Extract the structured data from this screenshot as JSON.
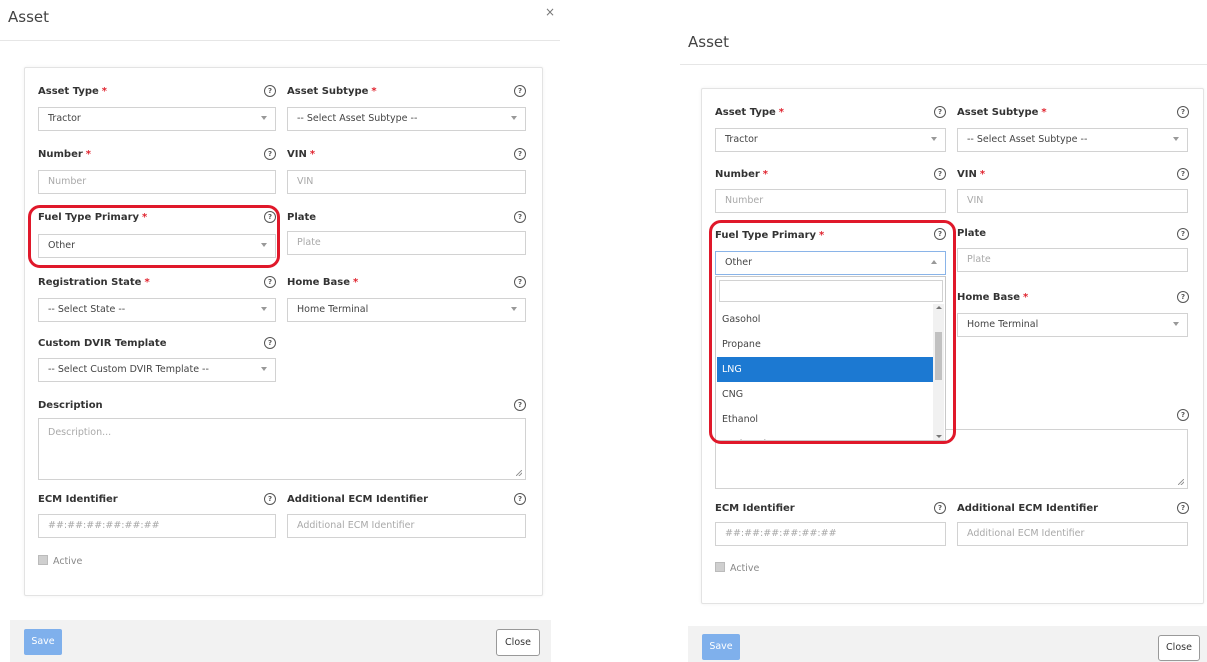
{
  "modal": {
    "title": "Asset",
    "close_x": "×",
    "fields": {
      "asset_type": {
        "label": "Asset Type",
        "value": "Tractor"
      },
      "asset_subtype": {
        "label": "Asset Subtype",
        "value": "-- Select Asset Subtype --"
      },
      "number": {
        "label": "Number",
        "placeholder": "Number"
      },
      "vin": {
        "label": "VIN",
        "placeholder": "VIN"
      },
      "fuel_type_primary": {
        "label": "Fuel Type Primary",
        "value": "Other"
      },
      "plate": {
        "label": "Plate",
        "placeholder": "Plate"
      },
      "registration_state": {
        "label": "Registration State",
        "value": "-- Select State --"
      },
      "home_base": {
        "label": "Home Base",
        "value": "Home Terminal"
      },
      "custom_dvir_template": {
        "label": "Custom DVIR Template",
        "value": "-- Select Custom DVIR Template --"
      },
      "description": {
        "label": "Description",
        "placeholder": "Description..."
      },
      "ecm_identifier": {
        "label": "ECM Identifier",
        "placeholder": "##:##:##:##:##:##"
      },
      "additional_ecm_identifier": {
        "label": "Additional ECM Identifier",
        "placeholder": "Additional ECM Identifier"
      },
      "active": {
        "label": "Active",
        "checked": true
      }
    },
    "required_marker": "*",
    "help_glyph": "?",
    "buttons": {
      "save": "Save",
      "close": "Close"
    }
  },
  "dropdown": {
    "search_value": "",
    "options": [
      "Gasohol",
      "Propane",
      "LNG",
      "CNG",
      "Ethanol",
      "Methanol"
    ],
    "selected": "LNG"
  },
  "colors": {
    "required": "#e0242f",
    "highlight": "#e0182a",
    "selected_option": "#1c79d2",
    "save_button": "#7fb0ec"
  }
}
